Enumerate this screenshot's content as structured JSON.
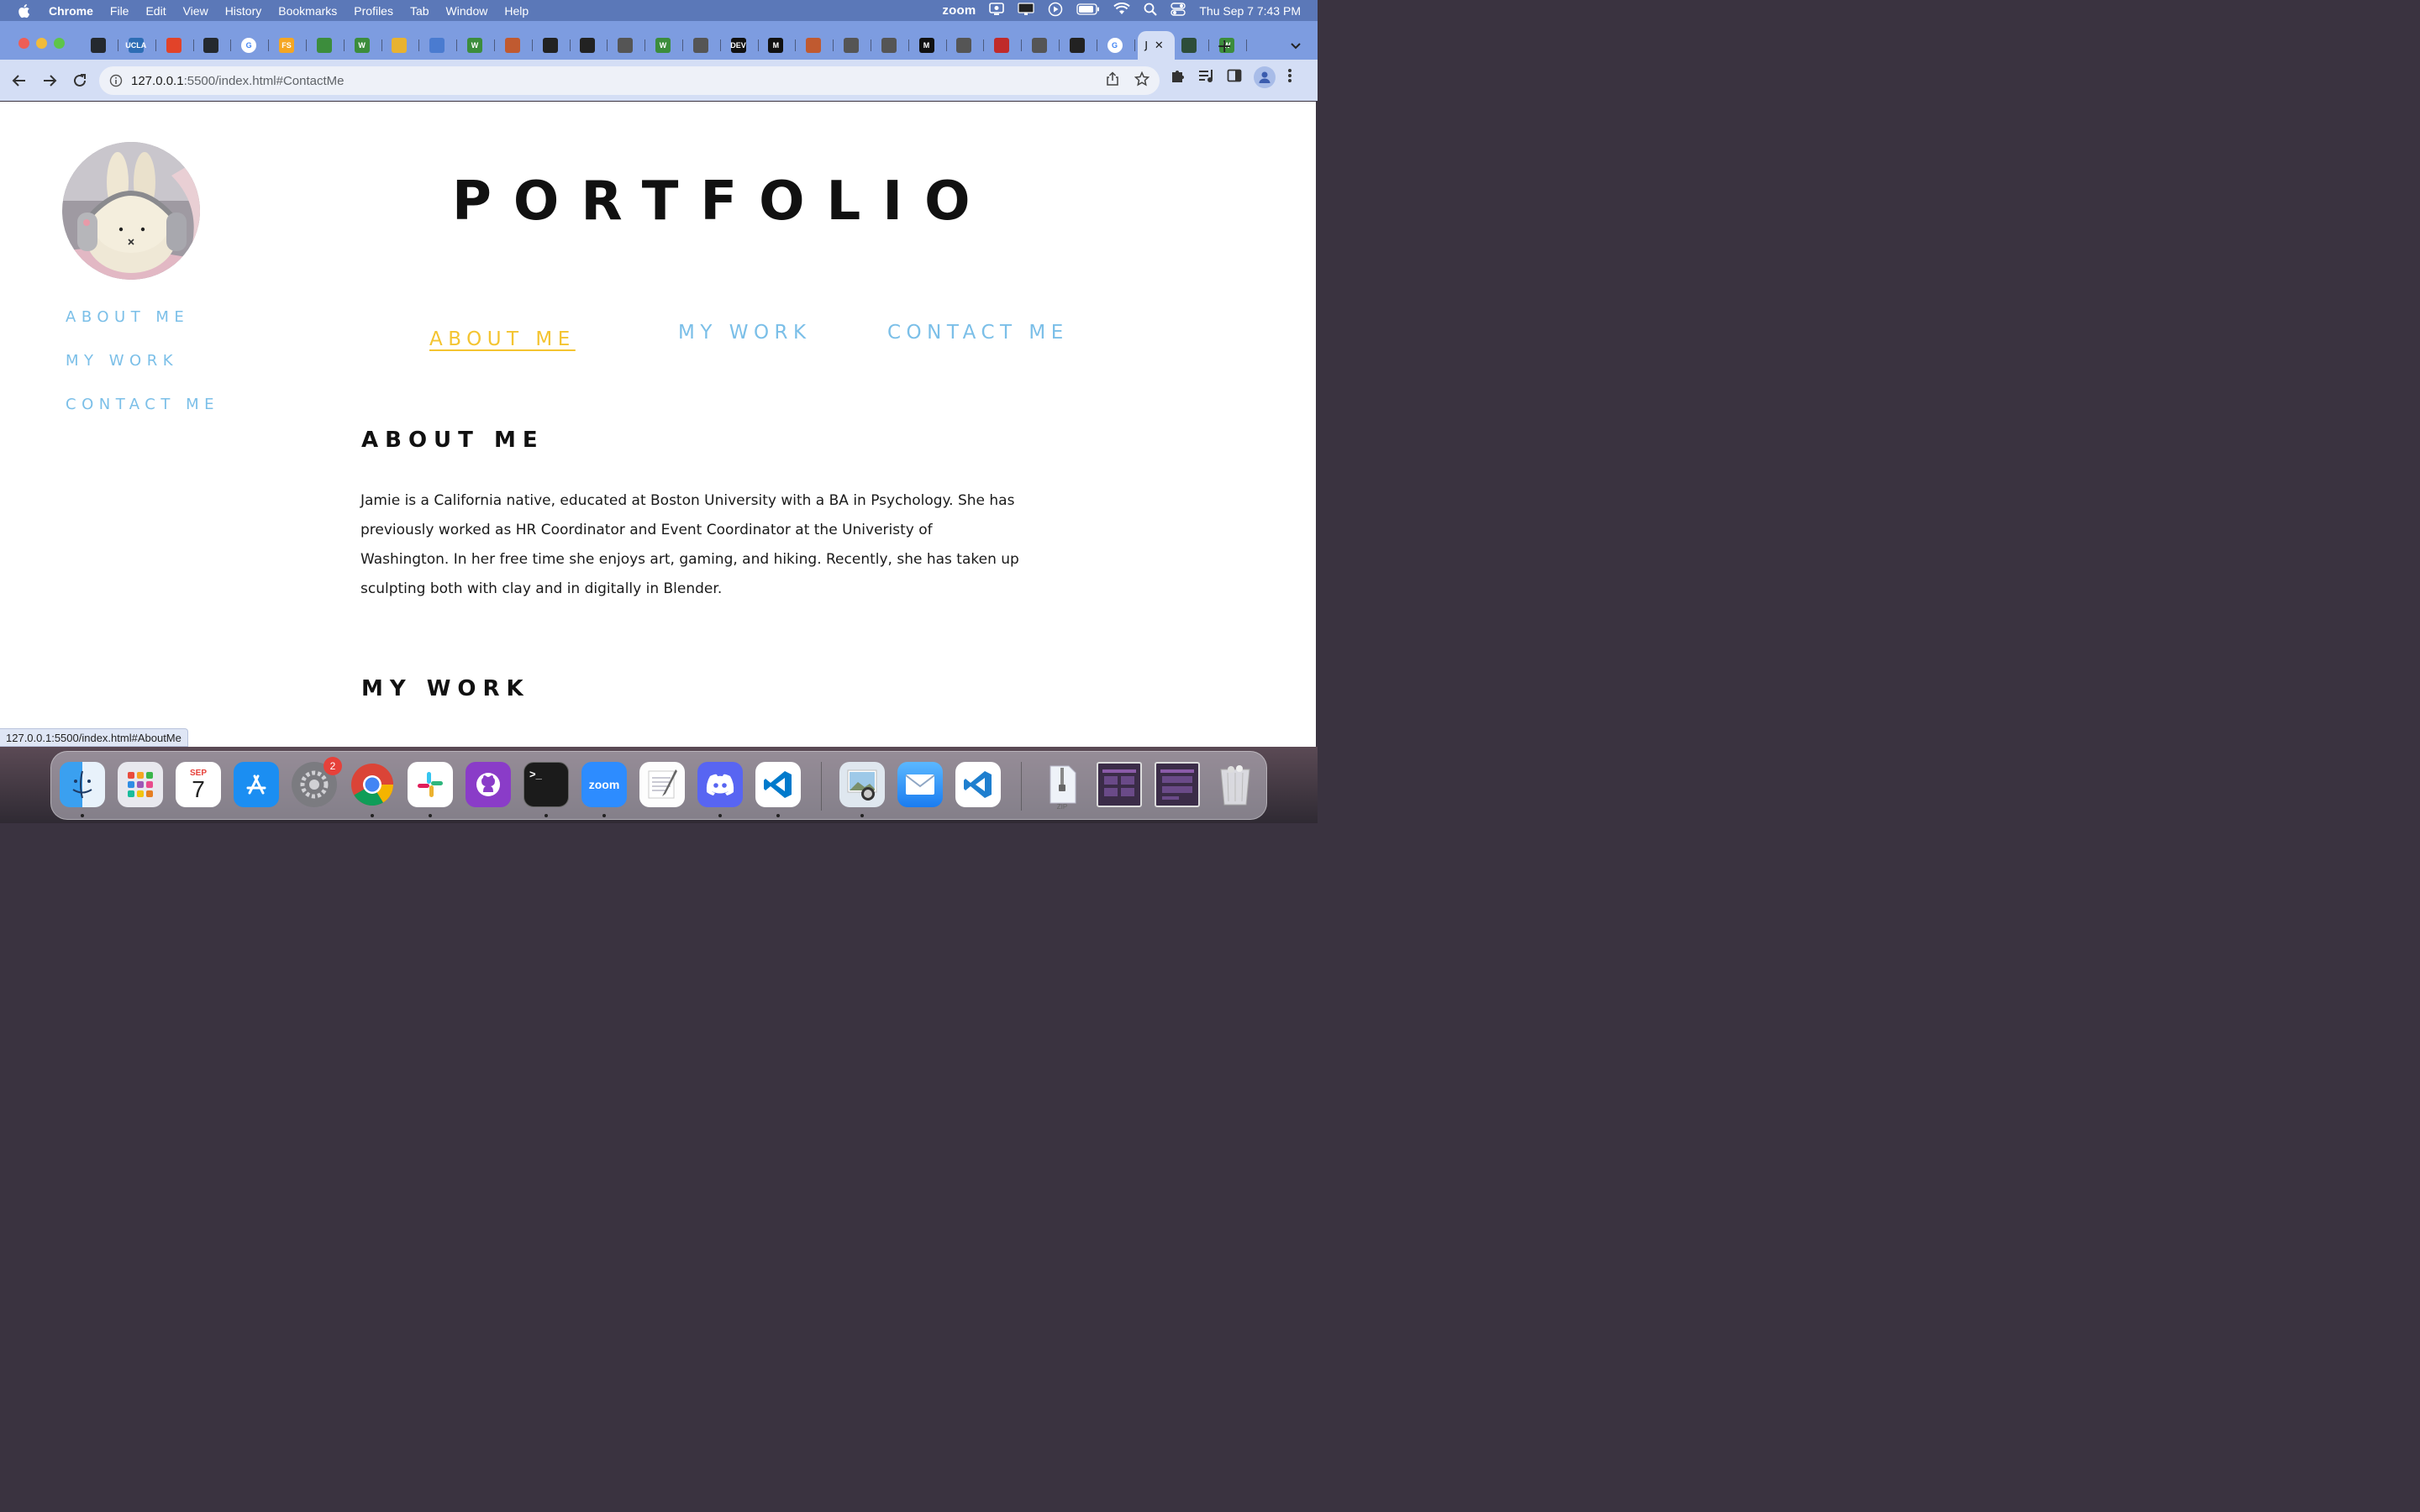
{
  "menubar": {
    "app_name": "Chrome",
    "menus": [
      "File",
      "Edit",
      "View",
      "History",
      "Bookmarks",
      "Profiles",
      "Tab",
      "Window",
      "Help"
    ],
    "zoom_label": "zoom",
    "datetime": "Thu Sep 7  7:43 PM"
  },
  "tabs": {
    "count_visible": 29,
    "active_title": "J",
    "close_glyph": "✕",
    "new_tab_glyph": "+",
    "favicon_labels": [
      "",
      "UCLA",
      "",
      "",
      "G",
      "FS",
      "",
      "W",
      "",
      "",
      "W",
      "",
      "",
      "",
      "",
      "W",
      "",
      "DEV",
      "M",
      "",
      "",
      "",
      "M",
      "",
      "",
      "",
      "",
      "G",
      "",
      "W"
    ]
  },
  "toolbar": {
    "url_host": "127.0.0.1",
    "url_path": ":5500/index.html#ContactMe"
  },
  "page": {
    "title": "PORTFOLIO",
    "sidenav": [
      "ABOUT ME",
      "MY WORK",
      "CONTACT ME"
    ],
    "topnav": {
      "about": "ABOUT ME",
      "work": "MY WORK",
      "contact": "CONTACT ME",
      "active": "about"
    },
    "about_heading": "ABOUT ME",
    "about_text": "Jamie is a California native, educated at Boston University with a BA in Psychology. She has previously worked as HR Coordinator and Event Coordinator at the Univeristy of Washington. In her free time she enjoys art, gaming, and hiking. Recently, she has taken up sculpting both with clay and in digitally in Blender.",
    "work_heading": "MY WORK",
    "status_url": "127.0.0.1:5500/index.html#AboutMe"
  },
  "dock": {
    "calendar_month": "SEP",
    "calendar_day": "7",
    "settings_badge": "2",
    "zoom_label": "zoom",
    "terminal_glyph": ">_",
    "zip_label": "ZIP",
    "apps": [
      "finder",
      "launchpad",
      "calendar",
      "app-store",
      "system-settings",
      "chrome",
      "slack",
      "github-desktop",
      "terminal",
      "zoom",
      "textedit",
      "discord",
      "vscode",
      "preview",
      "mail",
      "vscode-insiders",
      "zip-archive",
      "screenshot-1",
      "screenshot-2",
      "trash"
    ]
  },
  "colors": {
    "nav_link": "#7bbfe8",
    "nav_active": "#f4c430",
    "menubar_bg": "#5b78b8",
    "tabstrip_bg": "#7d9ce0",
    "toolbar_bg": "#d4def5"
  }
}
